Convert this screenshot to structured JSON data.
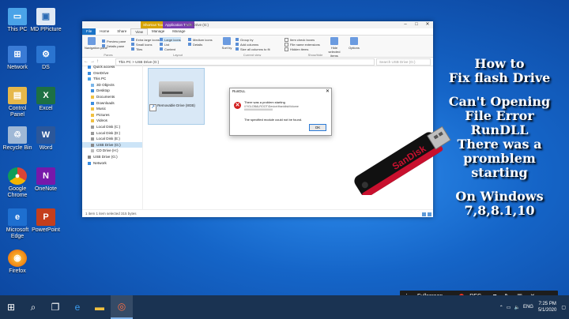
{
  "desktop": {
    "icons": [
      {
        "label": "This PC",
        "icon": "pc-icon"
      },
      {
        "label": "MD PPicture",
        "icon": "image-icon"
      },
      {
        "label": "Network",
        "icon": "network-icon"
      },
      {
        "label": "DS",
        "icon": "gear-icon"
      },
      {
        "label": "Control Panel",
        "icon": "control-panel-icon"
      },
      {
        "label": "Excel",
        "icon": "excel-icon"
      },
      {
        "label": "Recycle Bin",
        "icon": "recycle-bin-icon"
      },
      {
        "label": "Word",
        "icon": "word-icon"
      },
      {
        "label": "Google Chrome",
        "icon": "chrome-icon"
      },
      {
        "label": "OneNote",
        "icon": "onenote-icon"
      },
      {
        "label": "Microsoft Edge",
        "icon": "edge-icon"
      },
      {
        "label": "PowerPoint",
        "icon": "powerpoint-icon"
      },
      {
        "label": "Firefox",
        "icon": "firefox-icon"
      }
    ]
  },
  "explorer": {
    "context_tabs": [
      "Shortcut Tools",
      "Application Tools"
    ],
    "title": "USB Drive (G:)",
    "ribbon_tabs": [
      "File",
      "Home",
      "Share",
      "View",
      "Manage",
      "Manage"
    ],
    "ribbon": {
      "panes": {
        "navigation": "Navigation pane",
        "preview": "Preview pane",
        "details": "Details pane",
        "label": "Panes"
      },
      "layout": {
        "items": [
          "Extra large icons",
          "Large icons",
          "Medium icons",
          "Small icons",
          "List",
          "Details",
          "Tiles",
          "Content"
        ],
        "label": "Layout"
      },
      "current_view": {
        "sort": "Sort by",
        "group": "Group by",
        "add_columns": "Add columns",
        "size_all": "Size all columns to fit",
        "label": "Current view"
      },
      "show_hide": {
        "checkboxes": "Item check boxes",
        "extensions": "File name extensions",
        "hidden": "Hidden items",
        "hide_selected": "Hide selected items",
        "label": "Show/hide"
      },
      "options": "Options"
    },
    "address": "This PC  >  USB Drive (G:)",
    "search_placeholder": "Search USB Drive (G:)",
    "nav_items": [
      "Quick access",
      "OneDrive",
      "This PC",
      "3D Objects",
      "Desktop",
      "Documents",
      "Downloads",
      "Music",
      "Pictures",
      "Videos",
      "Local Disk (C:)",
      "Local Disk (D:)",
      "Local Disk (E:)",
      "USB Drive (G:)",
      "CD Drive (H:)",
      "USB Drive (G:)",
      "Network"
    ],
    "selected_nav": "USB Drive (G:)",
    "drive_label": "Removable Drive (8GB)",
    "status": "1 item    1 item selected  315 bytes"
  },
  "dialog": {
    "title": "RunDLL",
    "message1": "There was a problem starting",
    "message2": "\\\\?\\GLOBALROOT\\Device\\HarddiskVolume\\\\\\\\\\\\\\\\\\\\\\\\\\\\\\\\\\\\\\\\\\\\\\\\\\\\\\\\\\\\\\\\\\\\\\\\",
    "message3": "The specified module could not be found.",
    "ok": "OK"
  },
  "overlay_text": [
    "How to",
    "Fix flash Drive",
    "",
    "Can't Opening",
    "File  Error",
    "RunDLL",
    "There was a",
    "promblem",
    "starting",
    "",
    "On Windows",
    "7,8,8.1,10"
  ],
  "usb_brand": "SanDisk",
  "recorder": {
    "fullscreen": "Fullscreen",
    "rec": "REC"
  },
  "tray": {
    "time": "7:25 PM",
    "date": "5/1/2020",
    "lang": "ENG"
  }
}
